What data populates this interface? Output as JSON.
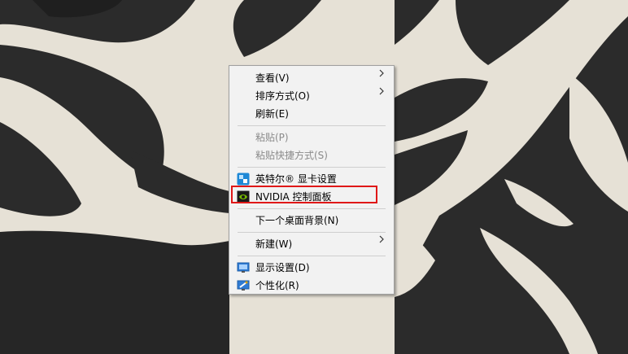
{
  "wallpaper": {
    "description_icon": "zebra-stripes-wallpaper",
    "colors": {
      "dark": "#2b2b2b",
      "light": "#e6e1d6"
    }
  },
  "context_menu": {
    "items": [
      {
        "label": "查看(V)",
        "has_submenu": true,
        "enabled": true
      },
      {
        "label": "排序方式(O)",
        "has_submenu": true,
        "enabled": true
      },
      {
        "label": "刷新(E)",
        "enabled": true
      },
      {
        "label": "粘贴(P)",
        "enabled": false
      },
      {
        "label": "粘贴快捷方式(S)",
        "enabled": false
      },
      {
        "label": "英特尔® 显卡设置",
        "icon": "intel-graphics-icon",
        "enabled": true
      },
      {
        "label": "NVIDIA 控制面板",
        "icon": "nvidia-icon",
        "enabled": true,
        "highlighted": true
      },
      {
        "label": "下一个桌面背景(N)",
        "enabled": true
      },
      {
        "label": "新建(W)",
        "has_submenu": true,
        "enabled": true
      },
      {
        "label": "显示设置(D)",
        "icon": "display-settings-icon",
        "enabled": true
      },
      {
        "label": "个性化(R)",
        "icon": "personalize-icon",
        "enabled": true
      }
    ]
  },
  "highlight_color": "#e01818"
}
